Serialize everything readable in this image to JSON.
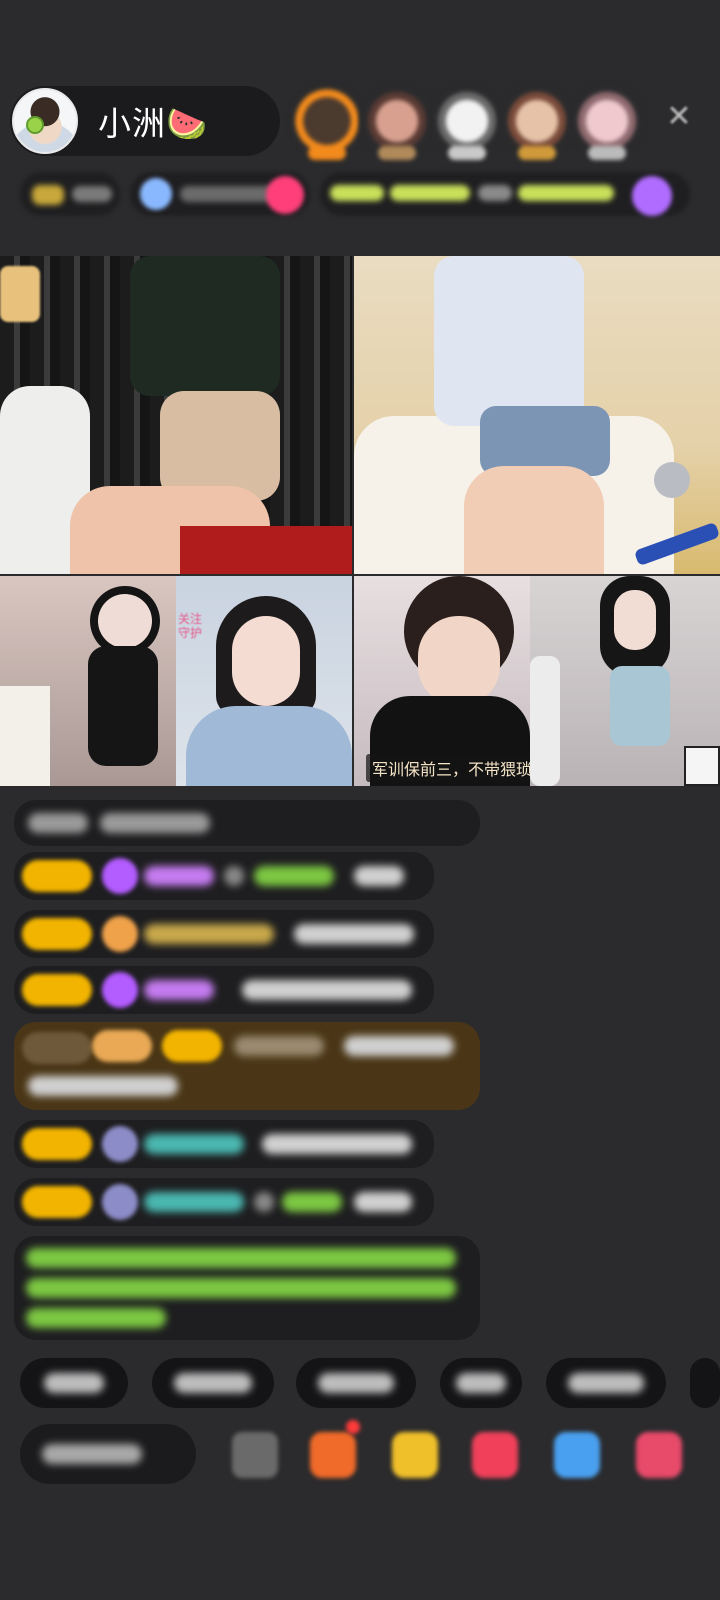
{
  "header": {
    "host_name": "小洲🍉",
    "close_label": "✕"
  },
  "video": {
    "caption": "军训保前三，不带猥琐",
    "side_note": "关注\n守护"
  },
  "colors": {
    "background": "#2b2b2d",
    "gold_badge": "#f2b400",
    "chat_green": "#7cc742",
    "chat_purple": "#b35cff"
  }
}
